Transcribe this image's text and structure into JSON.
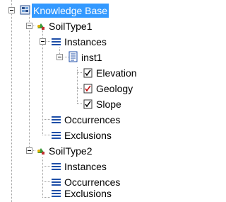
{
  "tree": {
    "root": {
      "label": "Knowledge Base",
      "icon": "knowledge-base-icon",
      "expanded": true,
      "selected": true
    },
    "nodes": [
      {
        "label": "SoilType1",
        "icon": "soil-type-icon",
        "expanded": true
      },
      {
        "label": "Instances",
        "icon": "list-icon",
        "expanded": true
      },
      {
        "label": "inst1",
        "icon": "document-icon",
        "expanded": true
      },
      {
        "label": "Elevation",
        "icon": "checklist-icon"
      },
      {
        "label": "Geology",
        "icon": "checklist-icon"
      },
      {
        "label": "Slope",
        "icon": "checklist-icon"
      },
      {
        "label": "Occurrences",
        "icon": "list-icon"
      },
      {
        "label": "Exclusions",
        "icon": "list-icon"
      },
      {
        "label": "SoilType2",
        "icon": "soil-type-icon",
        "expanded": true
      },
      {
        "label": "Instances",
        "icon": "list-icon"
      },
      {
        "label": "Occurrences",
        "icon": "list-icon"
      },
      {
        "label": "Exclusions",
        "icon": "list-icon"
      }
    ],
    "colors": {
      "selection": "#3399ff",
      "guide": "#a0a0a0"
    }
  }
}
